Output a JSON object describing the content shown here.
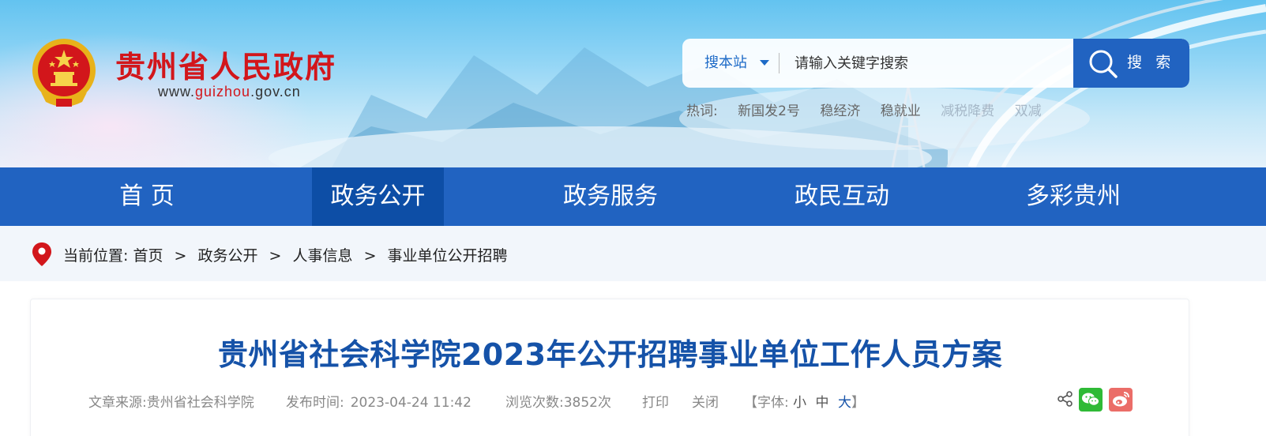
{
  "header": {
    "site_title": "贵州省人民政府",
    "site_url_prefix": "www.",
    "site_url_highlight": "guizhou",
    "site_url_suffix": ".gov.cn",
    "emblem_icon": "national-emblem-icon"
  },
  "search": {
    "scope_label": "搜本站",
    "placeholder": "请输入关键字搜索",
    "button_label": "搜 索",
    "hotwords_label": "热词:",
    "hotwords": [
      "新国发2号",
      "稳经济",
      "稳就业",
      "减税降费",
      "双减"
    ]
  },
  "nav": {
    "items": [
      {
        "label": "首  页"
      },
      {
        "label": "政务公开"
      },
      {
        "label": "政务服务"
      },
      {
        "label": "政民互动"
      },
      {
        "label": "多彩贵州"
      }
    ],
    "active_index": 1
  },
  "breadcrumb": {
    "prefix": "当前位置:",
    "items": [
      "首页",
      "政务公开",
      "人事信息",
      "事业单位公开招聘"
    ],
    "separator": ">"
  },
  "article": {
    "title": "贵州省社会科学院2023年公开招聘事业单位工作人员方案",
    "source_label": "文章来源:",
    "source": "贵州省社会科学院",
    "publish_label": "发布时间:",
    "publish_time": "2023-04-24 11:42",
    "views_label": "浏览次数:",
    "views": "3852次",
    "print_label": "打印",
    "close_label": "关闭",
    "font_label": "【字体:",
    "font_small": "小",
    "font_medium": "中",
    "font_large": "大",
    "font_end": "】"
  },
  "share": {
    "icons": [
      "share-icon",
      "wechat-icon",
      "weibo-icon"
    ]
  },
  "colors": {
    "nav_bg": "#2163c1",
    "nav_active": "#0d4ea6",
    "title_blue": "#1552a8",
    "brand_red": "#d2161b"
  }
}
